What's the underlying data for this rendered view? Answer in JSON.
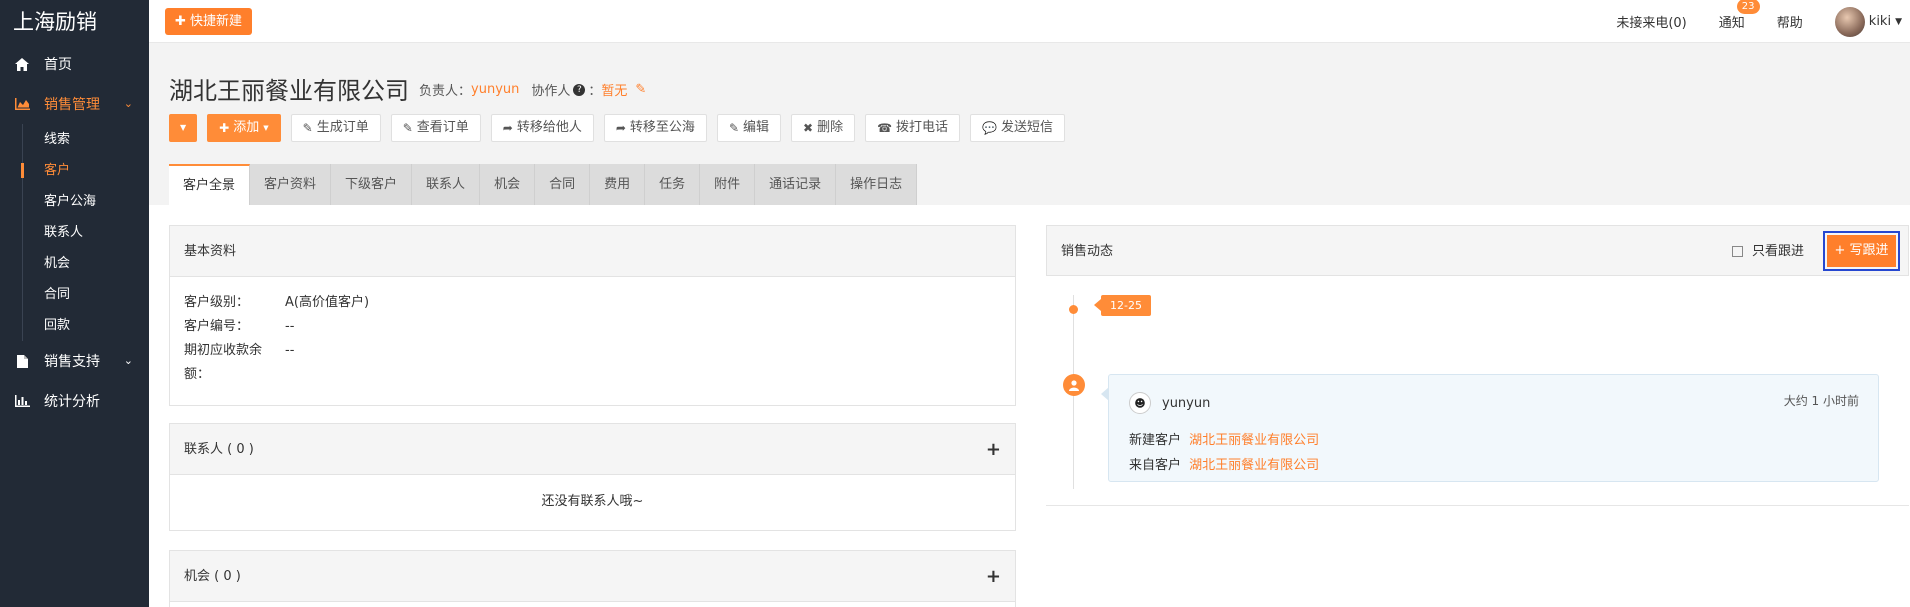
{
  "sidebar": {
    "brand": "上海励销",
    "items": [
      {
        "label": "首页",
        "icon": "home-icon"
      },
      {
        "label": "销售管理",
        "icon": "area-chart-icon",
        "active": true,
        "children": [
          "线索",
          "客户",
          "客户公海",
          "联系人",
          "机会",
          "合同",
          "回款"
        ],
        "active_child": "客户"
      },
      {
        "label": "销售支持",
        "icon": "file-icon"
      },
      {
        "label": "统计分析",
        "icon": "bar-chart-icon"
      }
    ]
  },
  "topbar": {
    "quick_new": "快捷新建",
    "missed_calls": "未接来电(0)",
    "notifications": "通知",
    "notification_count": "23",
    "help": "帮助",
    "username": "kiki"
  },
  "customer": {
    "name": "湖北王丽餐业有限公司",
    "owner_label": "负责人：",
    "owner": "yunyun",
    "collaborator_label": "协作人",
    "collaborator_suffix": "：",
    "collaborator": "暂无"
  },
  "actions": {
    "add": "添加",
    "generate_order": "生成订单",
    "view_order": "查看订单",
    "transfer": "转移给他人",
    "to_pool": "转移至公海",
    "edit": "编辑",
    "delete": "删除",
    "call": "拨打电话",
    "sms": "发送短信"
  },
  "tabs": [
    "客户全景",
    "客户资料",
    "下级客户",
    "联系人",
    "机会",
    "合同",
    "费用",
    "任务",
    "附件",
    "通话记录",
    "操作日志"
  ],
  "basic_info": {
    "title": "基本资料",
    "rows": [
      {
        "label": "客户级别：",
        "value": "A(高价值客户)"
      },
      {
        "label": "客户编号：",
        "value": "--"
      },
      {
        "label": "期初应收款余",
        "value": "--"
      },
      {
        "label": "额：",
        "value": ""
      }
    ]
  },
  "contacts_panel": {
    "title": "联系人 ( 0 )",
    "empty": "还没有联系人哦~"
  },
  "opportunity_panel": {
    "title": "机会 ( 0 )"
  },
  "sales_activity": {
    "title": "销售动态",
    "only_follow": "只看跟进",
    "write_follow": "+ 写跟进",
    "date": "12-25",
    "entry": {
      "user": "yunyun",
      "time": "大约 1 小时前",
      "line1_label": "新建客户",
      "line1_link": "湖北王丽餐业有限公司",
      "line2_label": "来自客户",
      "line2_link": "湖北王丽餐业有限公司"
    }
  }
}
